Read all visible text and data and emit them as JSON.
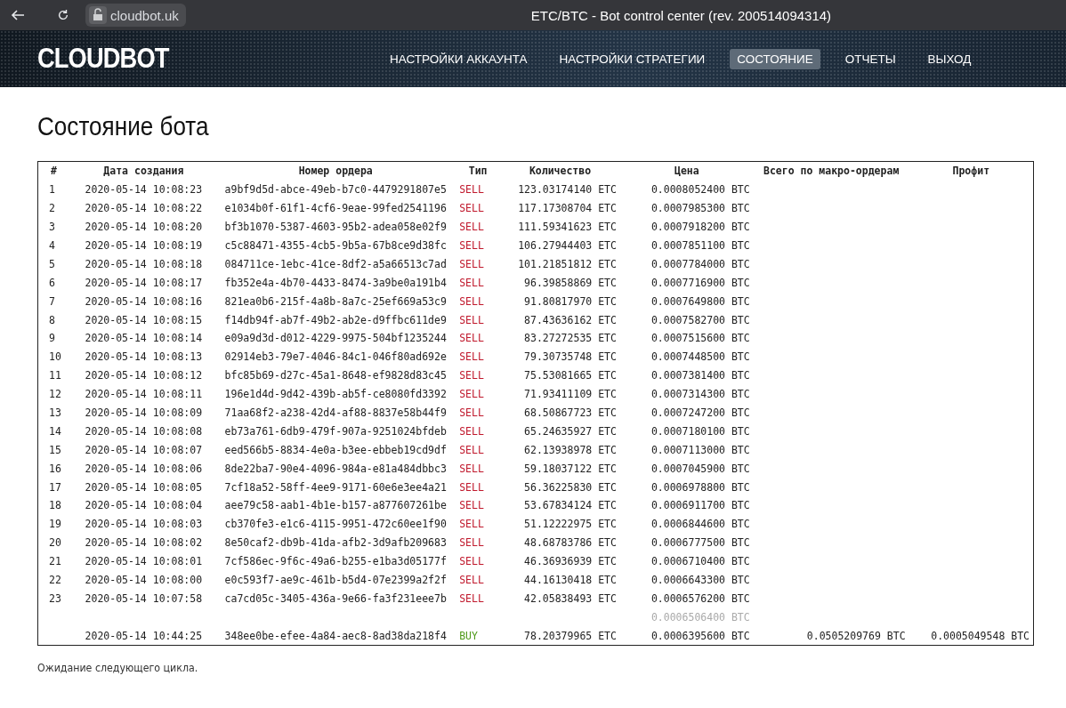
{
  "browser": {
    "url": "cloudbot.uk",
    "title": "ETC/BTC - Bot control center (rev. 200514094314)"
  },
  "header": {
    "logo": "CLOUDBOT",
    "nav": [
      {
        "label": "НАСТРОЙКИ АККАУНТА",
        "selected": false
      },
      {
        "label": "НАСТРОЙКИ СТРАТЕГИИ",
        "selected": false
      },
      {
        "label": "СОСТОЯНИЕ",
        "selected": true
      },
      {
        "label": "ОТЧЕТЫ",
        "selected": false
      },
      {
        "label": "ВЫХОД",
        "selected": false
      }
    ]
  },
  "page_title": "Состояние бота",
  "table": {
    "columns": [
      "#",
      "Дата создания",
      "Номер ордера",
      "Тип",
      "Количество",
      "Цена",
      "Всего по макро-ордерам",
      "Профит"
    ],
    "rows": [
      {
        "kind": "sell",
        "num": "1",
        "date": "2020-05-14 10:08:23",
        "order": "a9bf9d5d-abce-49eb-b7c0-4479291807e5",
        "type": "SELL",
        "qty": "123.03174140 ETC",
        "price": "0.0008052400 BTC"
      },
      {
        "kind": "sell",
        "num": "2",
        "date": "2020-05-14 10:08:22",
        "order": "e1034b0f-61f1-4cf6-9eae-99fed2541196",
        "type": "SELL",
        "qty": "117.17308704 ETC",
        "price": "0.0007985300 BTC"
      },
      {
        "kind": "sell",
        "num": "3",
        "date": "2020-05-14 10:08:20",
        "order": "bf3b1070-5387-4603-95b2-adea058e02f9",
        "type": "SELL",
        "qty": "111.59341623 ETC",
        "price": "0.0007918200 BTC"
      },
      {
        "kind": "sell",
        "num": "4",
        "date": "2020-05-14 10:08:19",
        "order": "c5c88471-4355-4cb5-9b5a-67b8ce9d38fc",
        "type": "SELL",
        "qty": "106.27944403 ETC",
        "price": "0.0007851100 BTC"
      },
      {
        "kind": "sell",
        "num": "5",
        "date": "2020-05-14 10:08:18",
        "order": "084711ce-1ebc-41ce-8df2-a5a66513c7ad",
        "type": "SELL",
        "qty": "101.21851812 ETC",
        "price": "0.0007784000 BTC"
      },
      {
        "kind": "sell",
        "num": "6",
        "date": "2020-05-14 10:08:17",
        "order": "fb352e4a-4b70-4433-8474-3a9be0a191b4",
        "type": "SELL",
        "qty": "96.39858869 ETC",
        "price": "0.0007716900 BTC"
      },
      {
        "kind": "sell",
        "num": "7",
        "date": "2020-05-14 10:08:16",
        "order": "821ea0b6-215f-4a8b-8a7c-25ef669a53c9",
        "type": "SELL",
        "qty": "91.80817970 ETC",
        "price": "0.0007649800 BTC"
      },
      {
        "kind": "sell",
        "num": "8",
        "date": "2020-05-14 10:08:15",
        "order": "f14db94f-ab7f-49b2-ab2e-d9ffbc611de9",
        "type": "SELL",
        "qty": "87.43636162 ETC",
        "price": "0.0007582700 BTC"
      },
      {
        "kind": "sell",
        "num": "9",
        "date": "2020-05-14 10:08:14",
        "order": "e09a9d3d-d012-4229-9975-504bf1235244",
        "type": "SELL",
        "qty": "83.27272535 ETC",
        "price": "0.0007515600 BTC"
      },
      {
        "kind": "sell",
        "num": "10",
        "date": "2020-05-14 10:08:13",
        "order": "02914eb3-79e7-4046-84c1-046f80ad692e",
        "type": "SELL",
        "qty": "79.30735748 ETC",
        "price": "0.0007448500 BTC"
      },
      {
        "kind": "sell",
        "num": "11",
        "date": "2020-05-14 10:08:12",
        "order": "bfc85b69-d27c-45a1-8648-ef9828d83c45",
        "type": "SELL",
        "qty": "75.53081665 ETC",
        "price": "0.0007381400 BTC"
      },
      {
        "kind": "sell",
        "num": "12",
        "date": "2020-05-14 10:08:11",
        "order": "196e1d4d-9d42-439b-ab5f-ce8080fd3392",
        "type": "SELL",
        "qty": "71.93411109 ETC",
        "price": "0.0007314300 BTC"
      },
      {
        "kind": "sell",
        "num": "13",
        "date": "2020-05-14 10:08:09",
        "order": "71aa68f2-a238-42d4-af88-8837e58b44f9",
        "type": "SELL",
        "qty": "68.50867723 ETC",
        "price": "0.0007247200 BTC"
      },
      {
        "kind": "sell",
        "num": "14",
        "date": "2020-05-14 10:08:08",
        "order": "eb73a761-6db9-479f-907a-9251024bfdeb",
        "type": "SELL",
        "qty": "65.24635927 ETC",
        "price": "0.0007180100 BTC"
      },
      {
        "kind": "sell",
        "num": "15",
        "date": "2020-05-14 10:08:07",
        "order": "eed566b5-8834-4e0a-b3ee-ebbeb19cd9df",
        "type": "SELL",
        "qty": "62.13938978 ETC",
        "price": "0.0007113000 BTC"
      },
      {
        "kind": "sell",
        "num": "16",
        "date": "2020-05-14 10:08:06",
        "order": "8de22ba7-90e4-4096-984a-e81a484dbbc3",
        "type": "SELL",
        "qty": "59.18037122 ETC",
        "price": "0.0007045900 BTC"
      },
      {
        "kind": "sell",
        "num": "17",
        "date": "2020-05-14 10:08:05",
        "order": "7cf18a52-58ff-4ee9-9171-60e6e3ee4a21",
        "type": "SELL",
        "qty": "56.36225830 ETC",
        "price": "0.0006978800 BTC"
      },
      {
        "kind": "sell",
        "num": "18",
        "date": "2020-05-14 10:08:04",
        "order": "aee79c58-aab1-4b1e-b157-a877607261be",
        "type": "SELL",
        "qty": "53.67834124 ETC",
        "price": "0.0006911700 BTC"
      },
      {
        "kind": "sell",
        "num": "19",
        "date": "2020-05-14 10:08:03",
        "order": "cb370fe3-e1c6-4115-9951-472c60ee1f90",
        "type": "SELL",
        "qty": "51.12222975 ETC",
        "price": "0.0006844600 BTC"
      },
      {
        "kind": "sell",
        "num": "20",
        "date": "2020-05-14 10:08:02",
        "order": "8e50caf2-db9b-41da-afb2-3d9afb209683",
        "type": "SELL",
        "qty": "48.68783786 ETC",
        "price": "0.0006777500 BTC"
      },
      {
        "kind": "sell",
        "num": "21",
        "date": "2020-05-14 10:08:01",
        "order": "7cf586ec-9f6c-49a6-b255-e1ba3d05177f",
        "type": "SELL",
        "qty": "46.36936939 ETC",
        "price": "0.0006710400 BTC"
      },
      {
        "kind": "sell",
        "num": "22",
        "date": "2020-05-14 10:08:00",
        "order": "e0c593f7-ae9c-461b-b5d4-07e2399a2f2f",
        "type": "SELL",
        "qty": "44.16130418 ETC",
        "price": "0.0006643300 BTC"
      },
      {
        "kind": "sell",
        "num": "23",
        "date": "2020-05-14 10:07:58",
        "order": "ca7cd05c-3405-436a-9e66-fa3f231eee7b",
        "type": "SELL",
        "qty": "42.05838493 ETC",
        "price": "0.0006576200 BTC"
      },
      {
        "kind": "pending",
        "price": "0.0006506400 BTC"
      },
      {
        "kind": "buy",
        "date": "2020-05-14 10:44:25",
        "order": "348ee0be-efee-4a84-aec8-8ad38da218f4",
        "type": "BUY",
        "qty": "78.20379965 ETC",
        "price": "0.0006395600 BTC",
        "total": "0.0505209769 BTC",
        "profit": "0.0005049548 BTC"
      }
    ]
  },
  "status": "Ожидание следующего цикла."
}
